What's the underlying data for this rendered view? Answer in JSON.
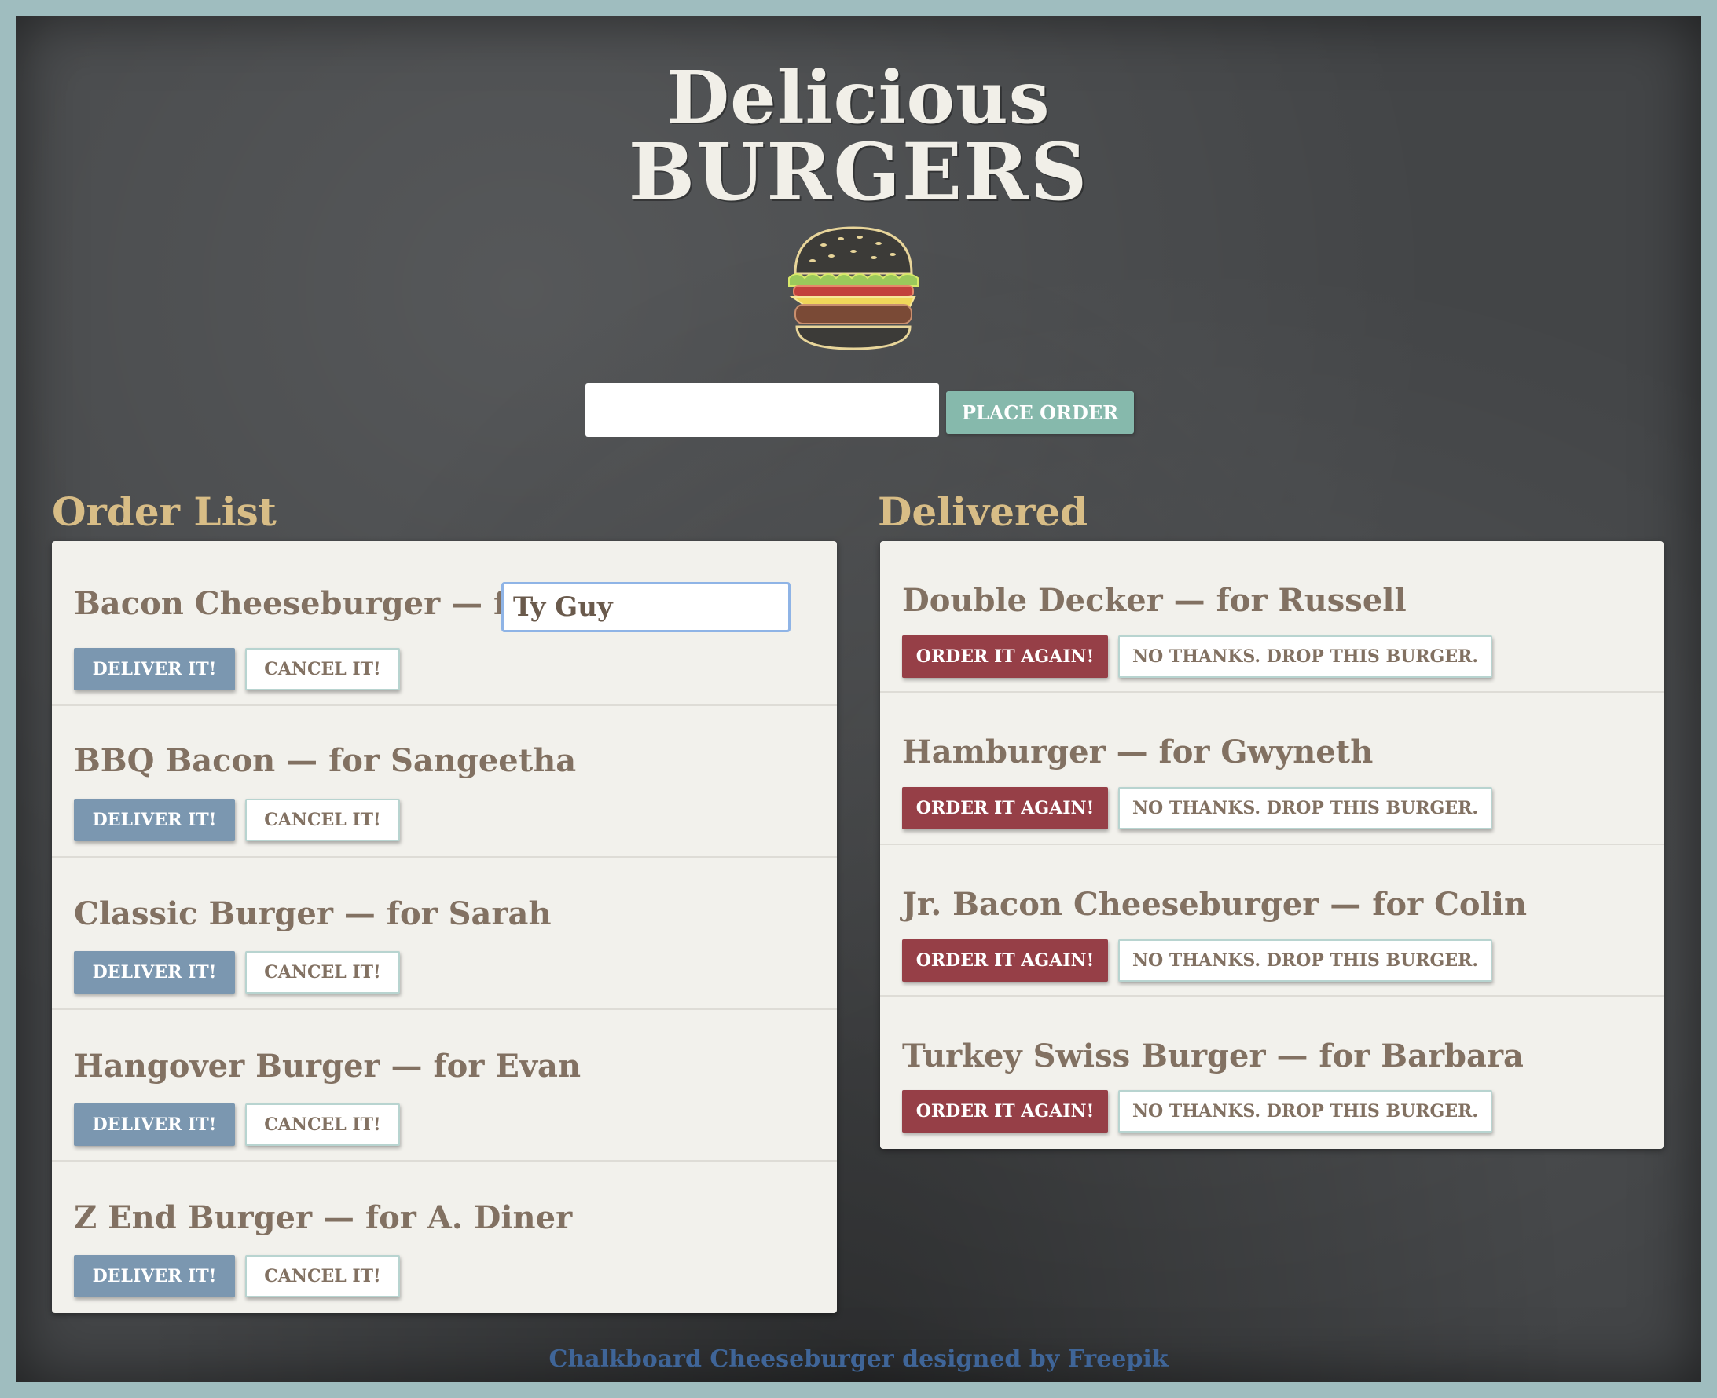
{
  "header": {
    "title_line1": "Delicious",
    "title_line2": "BURGERS"
  },
  "order_form": {
    "input_value": "",
    "button_label": "PLACE ORDER"
  },
  "order_list": {
    "heading": "Order List",
    "deliver_label": "DELIVER IT!",
    "cancel_label": "CANCEL IT!",
    "items": [
      {
        "title": "Bacon Cheeseburger — for",
        "edit_value": "Ty Guy"
      },
      {
        "title": "BBQ Bacon — for Sangeetha"
      },
      {
        "title": "Classic Burger — for Sarah"
      },
      {
        "title": "Hangover Burger — for Evan"
      },
      {
        "title": "Z End Burger — for A. Diner"
      }
    ]
  },
  "delivered": {
    "heading": "Delivered",
    "again_label": "ORDER IT AGAIN!",
    "drop_label": "NO THANKS. DROP THIS BURGER.",
    "items": [
      {
        "title": "Double Decker — for Russell"
      },
      {
        "title": "Hamburger — for Gwyneth"
      },
      {
        "title": "Jr. Bacon Cheeseburger — for Colin"
      },
      {
        "title": "Turkey Swiss Burger — for Barbara"
      }
    ]
  },
  "footer": {
    "credit": "Chalkboard Cheeseburger designed by Freepik"
  },
  "colors": {
    "board": "#434547",
    "frame": "#9fbdbf",
    "heading_gold": "#d8bd86",
    "deliver_blue": "#7b97b0",
    "again_red": "#963f47",
    "place_green": "#86b9ac"
  }
}
